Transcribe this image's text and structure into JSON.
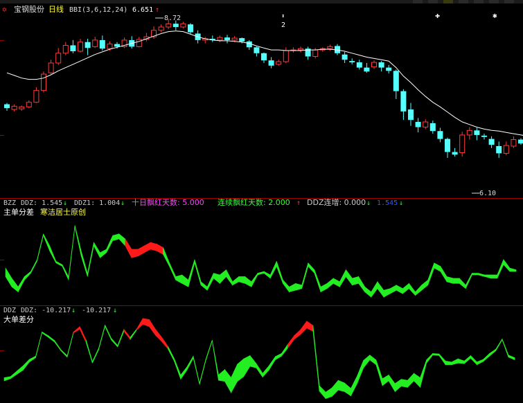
{
  "header": {
    "stock_icon": "star-of-david-icon",
    "stock_name": "宝钢股份",
    "period": "日线",
    "indicator": "BBI(3,6,12,24)",
    "indicator_value": "6.651",
    "indicator_arrow": "↑"
  },
  "colors": {
    "up": "#ff3b3b",
    "down": "#54ffff",
    "bbi": "#ffffff",
    "axis": "#a00000",
    "ddz_up": "#ff1a1a",
    "ddz_down": "#22ee22",
    "legend_ddz": "#cccccc",
    "legend_magenta": "#ff44ff",
    "legend_green": "#33ff33",
    "legend_blue": "#3355ff"
  },
  "price_annotations": {
    "high_label": "8.72",
    "low_label": "6.10",
    "marker_label": "2"
  },
  "panel2": {
    "legend": {
      "bzz_label": "BZZ",
      "ddz_text": "DDZ: 1.545",
      "ddz_arrow": "↓",
      "ddz1_text": "DDZ1: 1.004",
      "ddz1_arrow": "↓",
      "days10_text": "十日飘红天数: 5.000",
      "continuous_text": "连续飘红天数: 2.000",
      "continuous_arrow": "↑",
      "increase_text": "DDZ连增: 0.000",
      "increase_arrow": "↓",
      "last_text": "1.545",
      "last_arrow": "↓"
    },
    "title": "主单分差",
    "subtitle": "寒洁居士原创"
  },
  "panel3": {
    "legend": {
      "label": "DDZ",
      "ddz_text": "DDZ: -10.217",
      "ddz_arrow": "↓",
      "second_text": "-10.217",
      "second_arrow": "↓"
    },
    "title": "大单差分"
  },
  "chart_data": [
    {
      "type": "candlestick",
      "name": "宝钢股份 日线",
      "overlay": "BBI(3,6,12,24)",
      "annotations": [
        "8.72",
        "6.10"
      ],
      "candles": [
        [
          7.42,
          7.36,
          7.44,
          7.32
        ],
        [
          7.34,
          7.39,
          7.42,
          7.31
        ],
        [
          7.35,
          7.38,
          7.4,
          7.32
        ],
        [
          7.38,
          7.45,
          7.48,
          7.36
        ],
        [
          7.45,
          7.63,
          7.68,
          7.44
        ],
        [
          7.63,
          7.88,
          7.92,
          7.6
        ],
        [
          7.9,
          8.05,
          8.1,
          7.88
        ],
        [
          8.05,
          8.2,
          8.28,
          8.02
        ],
        [
          8.2,
          8.32,
          8.37,
          8.17
        ],
        [
          8.32,
          8.23,
          8.4,
          8.2
        ],
        [
          8.23,
          8.37,
          8.42,
          8.21
        ],
        [
          8.37,
          8.28,
          8.42,
          8.17
        ],
        [
          8.3,
          8.4,
          8.45,
          8.28
        ],
        [
          8.4,
          8.27,
          8.47,
          8.24
        ],
        [
          8.27,
          8.34,
          8.38,
          8.24
        ],
        [
          8.34,
          8.3,
          8.37,
          8.27
        ],
        [
          8.3,
          8.4,
          8.44,
          8.28
        ],
        [
          8.4,
          8.3,
          8.46,
          8.27
        ],
        [
          8.3,
          8.41,
          8.45,
          8.29
        ],
        [
          8.41,
          8.45,
          8.51,
          8.38
        ],
        [
          8.45,
          8.55,
          8.61,
          8.42
        ],
        [
          8.55,
          8.6,
          8.64,
          8.52
        ],
        [
          8.6,
          8.65,
          8.72,
          8.57
        ],
        [
          8.65,
          8.6,
          8.7,
          8.55
        ],
        [
          8.6,
          8.65,
          8.68,
          8.58
        ],
        [
          8.64,
          8.52,
          8.66,
          8.49
        ],
        [
          8.5,
          8.4,
          8.55,
          8.35
        ],
        [
          8.4,
          8.42,
          8.45,
          8.35
        ],
        [
          8.42,
          8.4,
          8.47,
          8.37
        ],
        [
          8.4,
          8.44,
          8.47,
          8.37
        ],
        [
          8.44,
          8.4,
          8.48,
          8.35
        ],
        [
          8.4,
          8.43,
          8.46,
          8.37
        ],
        [
          8.43,
          8.38,
          8.44,
          8.35
        ],
        [
          8.38,
          8.29,
          8.4,
          8.25
        ],
        [
          8.29,
          8.2,
          8.3,
          8.15
        ],
        [
          8.2,
          8.09,
          8.21,
          8.05
        ],
        [
          8.09,
          8.01,
          8.14,
          7.97
        ],
        [
          8.03,
          8.07,
          8.1,
          8.01
        ],
        [
          8.07,
          8.24,
          8.29,
          8.05
        ],
        [
          8.24,
          8.25,
          8.29,
          8.21
        ],
        [
          8.25,
          8.27,
          8.3,
          8.21
        ],
        [
          8.27,
          8.15,
          8.3,
          8.1
        ],
        [
          8.15,
          8.25,
          8.28,
          8.12
        ],
        [
          8.25,
          8.27,
          8.29,
          8.22
        ],
        [
          8.27,
          8.3,
          8.33,
          8.24
        ],
        [
          8.31,
          8.2,
          8.34,
          8.17
        ],
        [
          8.18,
          8.1,
          8.22,
          8.05
        ],
        [
          8.08,
          8.06,
          8.12,
          8.03
        ],
        [
          8.06,
          7.98,
          8.1,
          7.95
        ],
        [
          7.98,
          7.92,
          8.05,
          7.9
        ],
        [
          7.99,
          8.06,
          8.09,
          7.96
        ],
        [
          8.06,
          7.98,
          8.08,
          7.92
        ],
        [
          7.98,
          7.93,
          8.02,
          7.89
        ],
        [
          7.93,
          7.62,
          7.95,
          7.5
        ],
        [
          7.62,
          7.31,
          7.65,
          7.18
        ],
        [
          7.34,
          7.18,
          7.44,
          7.09
        ],
        [
          7.15,
          7.07,
          7.21,
          6.99
        ],
        [
          7.07,
          7.15,
          7.19,
          7.04
        ],
        [
          7.13,
          7.01,
          7.17,
          6.97
        ],
        [
          7.01,
          6.89,
          7.06,
          6.84
        ],
        [
          6.89,
          6.69,
          6.91,
          6.6
        ],
        [
          6.69,
          6.65,
          6.75,
          6.62
        ],
        [
          6.68,
          6.95,
          7.0,
          6.62
        ],
        [
          6.95,
          7.02,
          7.07,
          6.88
        ],
        [
          7.02,
          6.95,
          7.06,
          6.87
        ],
        [
          6.94,
          6.92,
          6.97,
          6.88
        ],
        [
          6.89,
          6.8,
          6.93,
          6.75
        ],
        [
          6.78,
          6.67,
          6.85,
          6.6
        ],
        [
          6.67,
          6.79,
          6.85,
          6.64
        ],
        [
          6.78,
          6.88,
          6.93,
          6.75
        ],
        [
          6.88,
          6.82,
          6.9,
          6.8
        ],
        [
          6.8,
          6.75,
          6.85,
          6.71
        ],
        [
          6.75,
          6.85,
          6.9,
          6.73
        ],
        [
          6.85,
          6.85,
          6.88,
          6.83
        ]
      ],
      "bbi": [
        7.9,
        7.86,
        7.82,
        7.8,
        7.8,
        7.82,
        7.87,
        7.93,
        7.98,
        8.03,
        8.08,
        8.13,
        8.18,
        8.22,
        8.26,
        8.29,
        8.32,
        8.35,
        8.38,
        8.42,
        8.46,
        8.5,
        8.53,
        8.54,
        8.53,
        8.49,
        8.45,
        8.42,
        8.4,
        8.39,
        8.39,
        8.38,
        8.37,
        8.35,
        8.31,
        8.28,
        8.25,
        8.25,
        8.24,
        8.24,
        8.24,
        8.25,
        8.25,
        8.26,
        8.26,
        8.25,
        8.23,
        8.2,
        8.17,
        8.14,
        8.12,
        8.1,
        8.08,
        7.98,
        7.85,
        7.75,
        7.64,
        7.54,
        7.45,
        7.38,
        7.3,
        7.22,
        7.15,
        7.11,
        7.07,
        7.04,
        7.02,
        7.01,
        6.99,
        6.97,
        6.95,
        6.93,
        6.91,
        6.9
      ]
    },
    {
      "type": "area",
      "name": "主单分差",
      "series": [
        {
          "name": "DDZ",
          "values": [
            0.3,
            -0.3,
            -0.8,
            -0.2,
            0.1,
            0.8,
            2.3,
            1.6,
            0.7,
            0.5,
            -0.2,
            2.8,
            1.3,
            0.0,
            1.8,
            1.2,
            1.4,
            2.2,
            2.3,
            2.0,
            1.4,
            1.4,
            1.6,
            1.8,
            1.7,
            1.5,
            0.6,
            -0.2,
            -0.1,
            -0.4,
            0.8,
            -0.5,
            -0.8,
            0.0,
            -0.1,
            0.2,
            -0.5,
            -0.2,
            -0.2,
            -0.5,
            0.0,
            0.1,
            -0.1,
            0.7,
            -0.4,
            -0.8,
            -0.6,
            -0.7,
            0.6,
            0.2,
            -0.8,
            -0.6,
            -0.3,
            -0.5,
            0.2,
            -0.3,
            -0.2,
            -0.8,
            -1.1,
            -0.5,
            -1.0,
            -0.9,
            -0.7,
            -0.9,
            -0.6,
            -1.1,
            -0.7,
            -0.4,
            0.6,
            0.4,
            -0.2,
            -0.3,
            -0.3,
            -0.7,
            0.0,
            0.0,
            -0.1,
            -0.1,
            -0.1,
            0.8,
            0.3,
            0.2
          ]
        },
        {
          "name": "DDZ1",
          "values": [
            -0.2,
            -0.8,
            -1.1,
            -0.4,
            0.0,
            0.7,
            2.2,
            1.3,
            0.6,
            0.4,
            -0.4,
            2.7,
            1.0,
            -0.2,
            1.6,
            0.9,
            1.2,
            1.9,
            2.0,
            1.6,
            0.9,
            1.0,
            1.2,
            1.4,
            1.3,
            1.1,
            0.4,
            -0.4,
            -0.6,
            -0.8,
            0.6,
            -0.7,
            -1.0,
            -0.3,
            -0.6,
            -0.2,
            -0.7,
            -0.5,
            -0.6,
            -0.8,
            -0.1,
            0.0,
            -0.3,
            0.4,
            -0.6,
            -1.1,
            -1.0,
            -0.9,
            0.4,
            0.0,
            -1.1,
            -0.9,
            -0.6,
            -0.8,
            -0.2,
            -0.7,
            -0.6,
            -1.1,
            -1.4,
            -0.9,
            -1.4,
            -1.2,
            -1.0,
            -1.2,
            -0.9,
            -1.3,
            -1.0,
            -0.7,
            0.3,
            0.1,
            -0.5,
            -0.6,
            -0.6,
            -0.9,
            -0.1,
            -0.1,
            -0.2,
            -0.3,
            -0.3,
            0.5,
            0.1,
            0.1
          ]
        }
      ]
    },
    {
      "type": "area",
      "name": "大单差分",
      "series": [
        {
          "name": "DDZ",
          "values": [
            -5.0,
            -4.8,
            -3.8,
            -2.8,
            -1.6,
            -1.0,
            3.5,
            2.8,
            1.9,
            0.2,
            -0.9,
            3.5,
            4.5,
            2.0,
            -2.0,
            0.5,
            4.8,
            2.3,
            1.0,
            4.0,
            2.5,
            4.0,
            6.0,
            5.8,
            4.0,
            2.5,
            0.8,
            -1.5,
            -4.5,
            -3.0,
            -1.0,
            -6.0,
            -1.5,
            2.0,
            -4.5,
            -3.5,
            -5.0,
            -2.5,
            -1.5,
            -0.9,
            -2.4,
            -4.2,
            -2.8,
            -1.1,
            -0.5,
            1.2,
            2.8,
            3.9,
            5.5,
            4.7,
            -6.5,
            -7.7,
            -6.9,
            -5.5,
            -6.0,
            -7.0,
            -4.7,
            -1.8,
            -0.8,
            -1.7,
            -5.2,
            -4.5,
            -6.1,
            -5.3,
            -5.5,
            -4.2,
            -5.0,
            -1.7,
            -0.5,
            -0.6,
            -1.9,
            -2.1,
            -1.5,
            -1.9,
            -0.9,
            -2.1,
            -1.6,
            -0.5,
            0.3,
            2.2,
            -0.8,
            -1.3
          ]
        },
        {
          "name": "DDZ1",
          "values": [
            -5.6,
            -5.2,
            -4.4,
            -3.6,
            -2.1,
            -1.3,
            3.3,
            2.5,
            1.6,
            0.0,
            -1.2,
            3.3,
            4.0,
            1.5,
            -2.3,
            0.2,
            4.5,
            2.0,
            0.7,
            3.6,
            2.1,
            3.8,
            4.9,
            4.5,
            2.9,
            1.7,
            0.3,
            -2.0,
            -5.3,
            -3.6,
            -1.4,
            -6.3,
            -1.8,
            1.8,
            -5.5,
            -5.7,
            -7.8,
            -5.7,
            -4.8,
            -2.9,
            -3.2,
            -4.9,
            -3.6,
            -1.7,
            -1.0,
            0.5,
            2.1,
            3.0,
            4.2,
            3.6,
            -7.5,
            -8.9,
            -8.5,
            -7.3,
            -7.6,
            -8.4,
            -6.1,
            -3.2,
            -1.7,
            -2.6,
            -6.5,
            -5.6,
            -7.6,
            -6.6,
            -6.8,
            -5.6,
            -6.8,
            -2.3,
            -0.8,
            -0.9,
            -2.6,
            -2.6,
            -2.3,
            -2.4,
            -1.4,
            -2.6,
            -2.0,
            -1.0,
            0.0,
            2.0,
            -1.2,
            -1.7
          ]
        }
      ]
    }
  ]
}
